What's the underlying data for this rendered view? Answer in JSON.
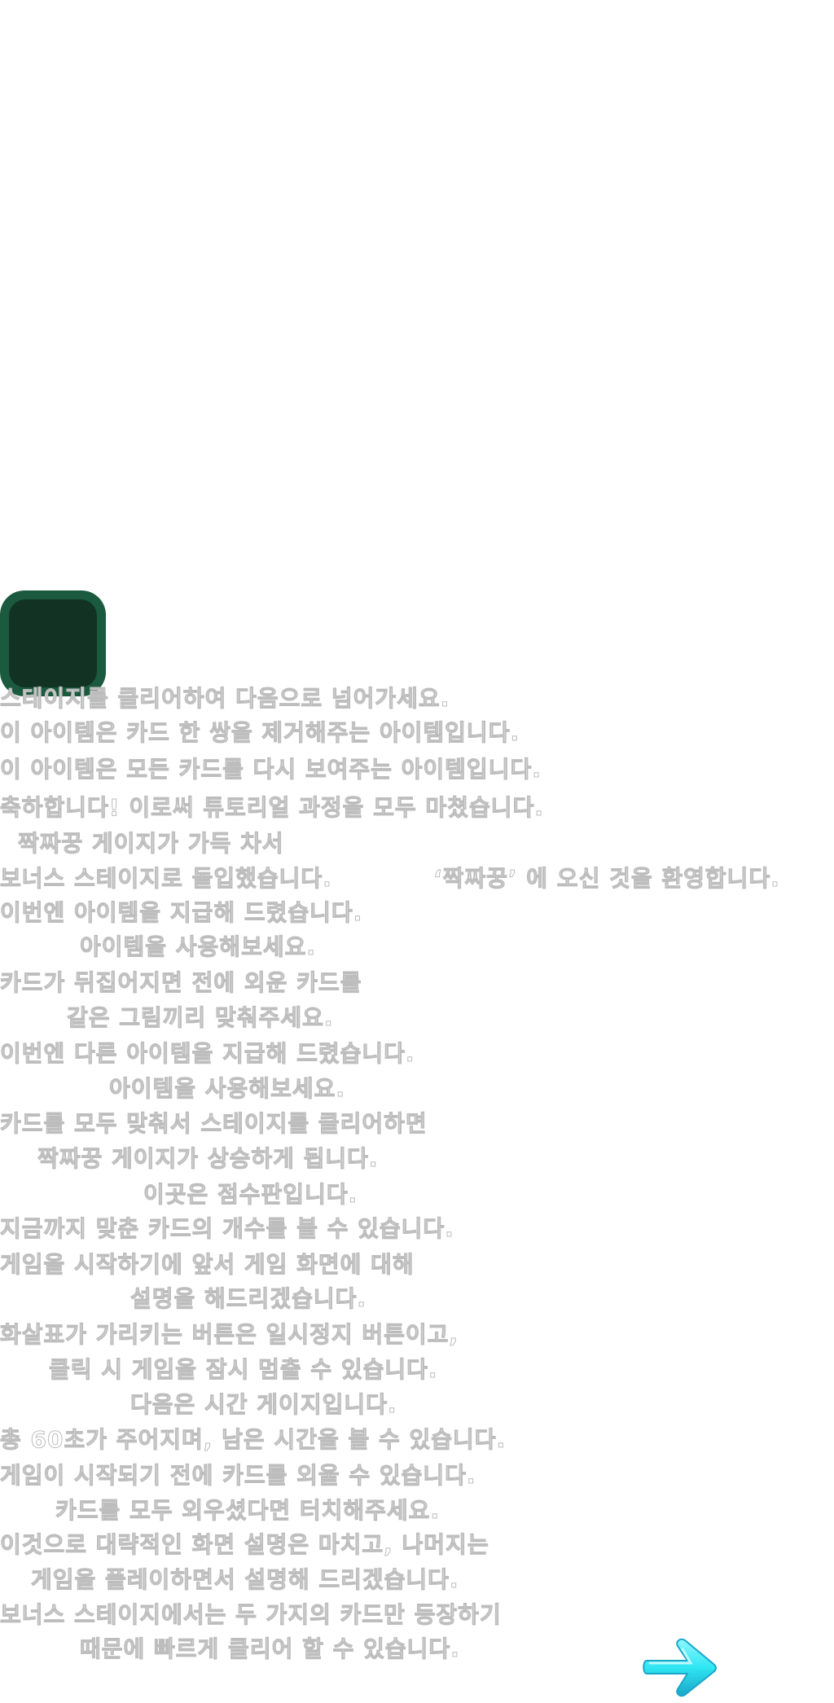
{
  "colors": {
    "card_outer": "#1b5a3f",
    "card_inner": "#123324",
    "text_fill": "#ffffff",
    "text_outline": "#bdbdbd",
    "arrow_fill": "#2ee6f2",
    "arrow_dark": "#1aa6c9"
  },
  "icons": {
    "next": "arrow-right-icon",
    "card": "card-placeholder"
  },
  "lines": [
    "스테이지를 클리어하여 다음으로 넘어가세요.",
    "이 아이템은 카드 한 쌍을 제거해주는 아이템입니다.",
    "이 아이템은 모든 카드를 다시 보여주는 아이템입니다.",
    "축하합니다! 이로써 튜토리얼 과정을 모두 마쳤습니다.",
    "짝짜꿍 게이지가 가득 차서",
    "보너스 스테이지로 돌입했습니다.",
    "‘짝짜꿍’ 에 오신 것을 환영합니다.",
    "이번엔 아이템을 지급해 드렸습니다.",
    "아이템을 사용해보세요.",
    "카드가 뒤집어지면 전에 외운 카드를",
    "같은 그림끼리 맞춰주세요.",
    "이번엔 다른 아이템을 지급해 드렸습니다.",
    "아이템을 사용해보세요.",
    "카드를 모두 맞춰서 스테이지를 클리어하면",
    "짝짜꿍 게이지가 상승하게 됩니다.",
    "이곳은 점수판입니다.",
    "지금까지 맞춘 카드의 개수를 볼 수 있습니다.",
    "게임을 시작하기에 앞서 게임 화면에 대해",
    "설명을 해드리겠습니다.",
    "화살표가 가리키는 버튼은 일시정지 버튼이고,",
    "클릭 시 게임을 잠시 멈출 수 있습니다.",
    "다음은 시간 게이지입니다.",
    "총 60초가 주어지며, 남은 시간을 볼 수 있습니다.",
    "게임이 시작되기 전에 카드를 외울 수 있습니다.",
    "카드를 모두 외우셨다면 터치해주세요.",
    "이것으로 대략적인 화면 설명은 마치고, 나머지는",
    "게임을 플레이하면서 설명해 드리겠습니다.",
    "보너스 스테이지에서는 두 가지의 카드만 등장하기",
    "때문에 빠르게 클리어 할 수 있습니다."
  ]
}
